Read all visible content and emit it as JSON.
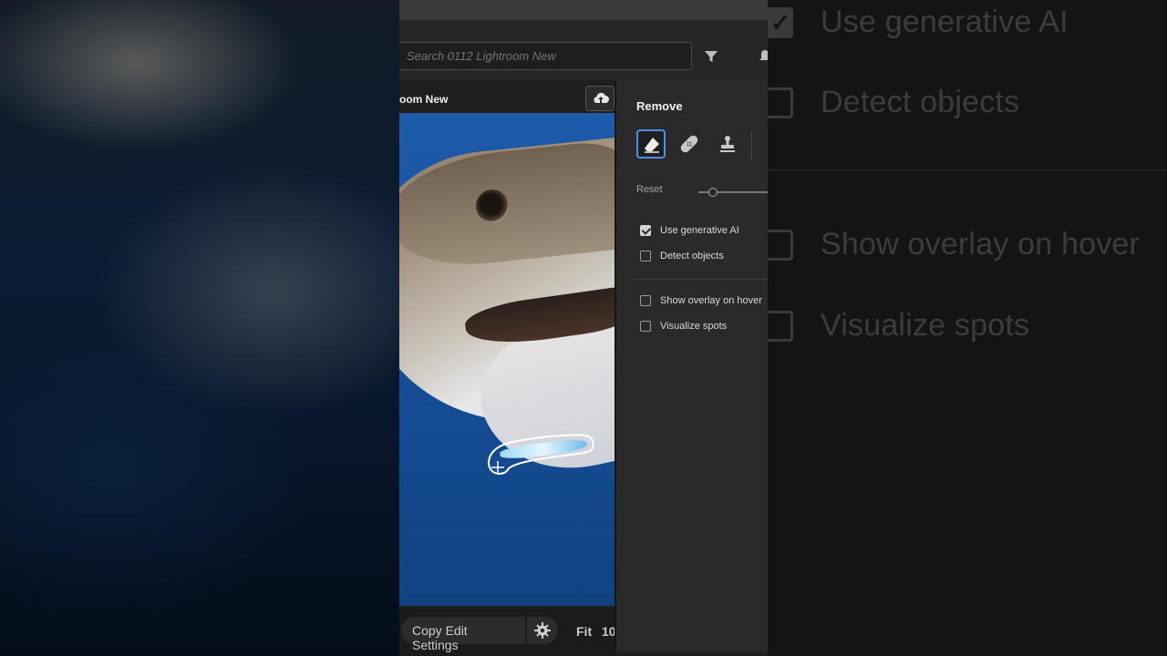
{
  "search": {
    "placeholder": "Search 0112 Lightroom New"
  },
  "album": {
    "title": "oom New"
  },
  "remove_panel": {
    "title": "Remove",
    "tools": [
      "eraser-tool",
      "heal-tool",
      "clone-stamp-tool"
    ],
    "reset_label": "Reset",
    "options": [
      {
        "label": "Use generative AI",
        "checked": true
      },
      {
        "label": "Detect objects",
        "checked": false
      },
      {
        "label": "Show overlay on hover",
        "checked": false
      },
      {
        "label": "Visualize spots",
        "checked": false
      }
    ]
  },
  "bottom_bar": {
    "copy_label": "Copy Edit Settings",
    "fit_label": "Fit",
    "zoom_label": "10"
  },
  "zoomed_panel": {
    "options": [
      {
        "label": "Use generative AI",
        "checked": true
      },
      {
        "label": "Detect objects",
        "checked": false
      },
      {
        "label": "Show overlay on hover",
        "checked": false
      },
      {
        "label": "Visualize spots",
        "checked": false
      }
    ]
  },
  "colors": {
    "accent": "#4a8ef0",
    "panel_bg": "#2a2a2a",
    "photo_water": "#17519c"
  }
}
